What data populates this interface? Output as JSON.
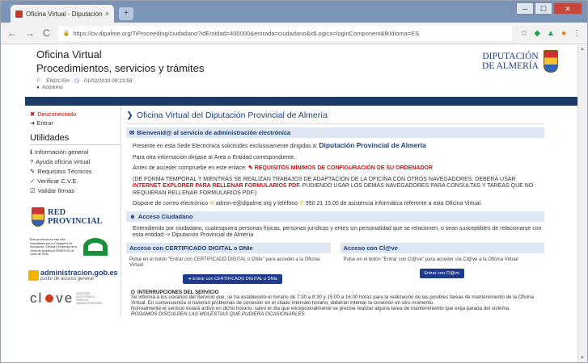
{
  "browser": {
    "tab_title": "Oficina Virtual - Diputación Prov...",
    "tab_close": "×",
    "new_tab": "+",
    "url": "https://ov.dipalme.org/TiProceeding/ciudadano?idEntidad=400000&entrada=ciudadano&idLogica=loginComponent&fkIdioma=ES",
    "nav": {
      "back": "←",
      "forward": "→",
      "reload": "C"
    },
    "window_controls": {
      "minimize": "─",
      "maximize": "☐",
      "close": "✕"
    }
  },
  "header": {
    "title_line1": "Oficina Virtual",
    "title_line2": "Procedimientos, servicios y trámites",
    "language": "ENGLISH",
    "datetime": "01/02/2019 09:23:59",
    "user": "Anónimo",
    "logo_line1": "DIPUTACIÓN",
    "logo_line2": "DE ALMERÍA"
  },
  "sidebar": {
    "status": "Desconectado",
    "login": "Entrar",
    "section_title": "Utilidades",
    "items": [
      {
        "label": "Información general",
        "icon": "info-icon",
        "glyph": "ℹ"
      },
      {
        "label": "Ayuda oficina virtual",
        "icon": "help-icon",
        "glyph": "?"
      },
      {
        "label": "Requisitos Técnicos",
        "icon": "wrench-icon",
        "glyph": "✎"
      },
      {
        "label": "Verificar C.V.E.",
        "icon": "check-icon",
        "glyph": "✓"
      },
      {
        "label": "Validar firmas",
        "icon": "checkbox-icon",
        "glyph": "☑"
      }
    ],
    "logos": {
      "red_provincial_1": "RED",
      "red_provincial_2": "PROVINCIAL",
      "junta_text": "Ente provincial en este sitio consolidado por la Consejería de Innovación, Ciencia y Empresa de la Junta de Andalucía ORDEN 22 de Junio de 2006",
      "administracion_1": "administracion.gob.es",
      "administracion_2": "punto de acceso general",
      "clave_text": "cl",
      "clave_text2": "ve",
      "clave_small": "IDENTIDAD ELECTRÓNICA PARA LAS ADMINISTRACIONES"
    }
  },
  "main": {
    "title": "Oficina Virtual del Diputación Provincial de Almería",
    "welcome_bar": "Bienvenid@ al servicio de administración electrónica",
    "p1_text": "Presente en esta Sede Electrónica solicitudes exclusivamente dirigidas a:",
    "p1_entity": "Diputación Provincial de Almería",
    "p2": "Para otra información diríjase al Área o Entidad correspondiente.",
    "p3_text": "Antes de acceder compruebe en este enlace:",
    "p3_link": "REQUISITOS MÍNIMOS DE CONFIGURACIÓN DE SU ORDENADOR",
    "p4_a": "(DE FORMA TEMPORAL Y MIENTRAS SE REALIZAN TRABAJOS DE ADAPTACIÓN DE LA OFICINA CON OTROS NAVEGADORES. DEBERÁ USAR",
    "p4_b": "INTERNET EXPLORER PARA RELLENAR FORMULARIOS PDF.",
    "p4_c": "PUDIENDO USAR LOS DEMÁS NAVEGADORES PARA CONSULTAS Y TAREAS QUE NO REQUIERAN RELLENAR FORMULARIOS PDF.)",
    "p5_a": "Dispone de correo electrónico",
    "p5_email": "admin-e@dipalme.org",
    "p5_b": "y teléfono",
    "p5_phone": "950 21 15 00",
    "p5_c": "de asistencia informática referente a esta Oficina Virtual.",
    "access_bar": "Acceso Ciudadano",
    "access_text": "Entendiendo por ciudadano, cualesquiera personas físicas, personas jurídicas y entes sin personalidad que se relacionen, o sean susceptibles de relacionarse con esta entidad -> Diputación Provincial de Almería",
    "cert_header": "Acceso con CERTIFICADO DIGITAL o DNIe",
    "cert_text": "Pulse en el botón \"Entrar con CERTIFICADO DIGITAL o DNIe\" para acceder a la Oficina Virtual",
    "cert_button": "Entrar con CERTIFICADO DIGITAL o DNIe",
    "clave_header": "Acceso con Cl@ve",
    "clave_text": "Pulse en el botón \"Entrar con Cl@ve\" para acceder vía Cl@ve a la Oficina Virtual",
    "clave_button": "Entrar con Cl@ve",
    "interrupt_title": "INTERRUPCIONES DEL SERVICIO",
    "interrupt_1": "Se informa a los usuarios del Servicio que, se ha establecido el horario de 7:30 a 8:30 y 15:00 a 16:00 horas para la realización de las posibles tareas de mantenimiento de la Oficina Virtual. En consecuencia si tuvieran problemas de conexión en el citado intervalo horario, deberán intentar la conexión en otro momento.",
    "interrupt_2": "Normalmente el servicio estará activo en dicho horario, salvo el día que excepcionalmente se precise realizar alguna tarea de mantenimiento que exija parada del sistema.",
    "interrupt_3": "ROGAMOS DISCULPEN LAS MOLESTIAS QUE PUDIERA OCASIONARLES."
  }
}
